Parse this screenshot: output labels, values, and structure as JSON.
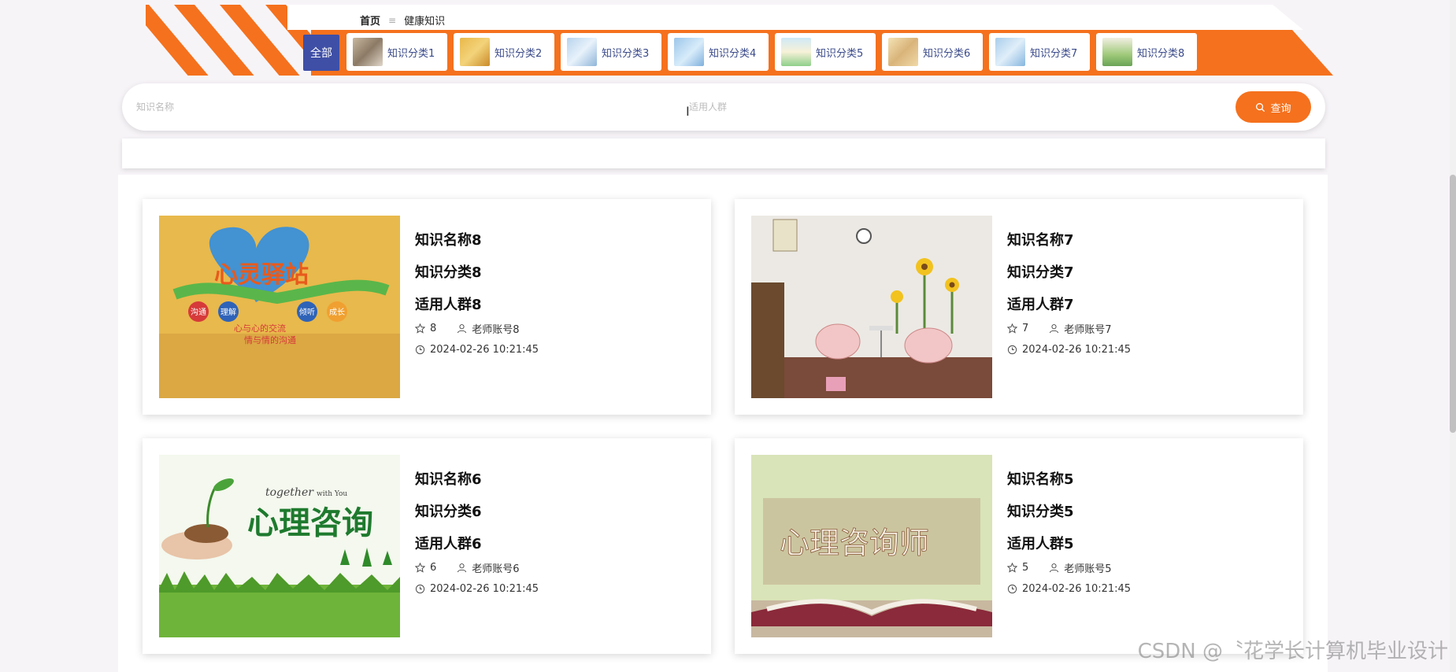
{
  "breadcrumb": {
    "home": "首页",
    "separator": "≡",
    "current": "健康知识"
  },
  "categories": {
    "all_label": "全部",
    "items": [
      {
        "label": "知识分类1"
      },
      {
        "label": "知识分类2"
      },
      {
        "label": "知识分类3"
      },
      {
        "label": "知识分类4"
      },
      {
        "label": "知识分类5"
      },
      {
        "label": "知识分类6"
      },
      {
        "label": "知识分类7"
      },
      {
        "label": "知识分类8"
      }
    ]
  },
  "search": {
    "name_placeholder": "知识名称",
    "crowd_placeholder": "适用人群",
    "query_label": "查询"
  },
  "cards": [
    {
      "name": "知识名称8",
      "category": "知识分类8",
      "crowd": "适用人群8",
      "likes": "8",
      "teacher": "老师账号8",
      "time": "2024-02-26 10:21:45",
      "image_text": [
        "心灵驿站",
        "沟通",
        "理解",
        "倾听",
        "成长",
        "心与心的交流",
        "情与情的沟通"
      ]
    },
    {
      "name": "知识名称7",
      "category": "知识分类7",
      "crowd": "适用人群7",
      "likes": "7",
      "teacher": "老师账号7",
      "time": "2024-02-26 10:21:45",
      "image_text": []
    },
    {
      "name": "知识名称6",
      "category": "知识分类6",
      "crowd": "适用人群6",
      "likes": "6",
      "teacher": "老师账号6",
      "time": "2024-02-26 10:21:45",
      "image_text": [
        "together",
        "with You",
        "心理咨询"
      ]
    },
    {
      "name": "知识名称5",
      "category": "知识分类5",
      "crowd": "适用人群5",
      "likes": "5",
      "teacher": "老师账号5",
      "time": "2024-02-26 10:21:45",
      "image_text": [
        "心理咨询师"
      ]
    }
  ],
  "watermark": "CSDN @〝花学长计算机毕业设计",
  "colors": {
    "accent": "#f5711d",
    "all_button": "#3f4fa6",
    "category_text": "#3a4a8a"
  }
}
